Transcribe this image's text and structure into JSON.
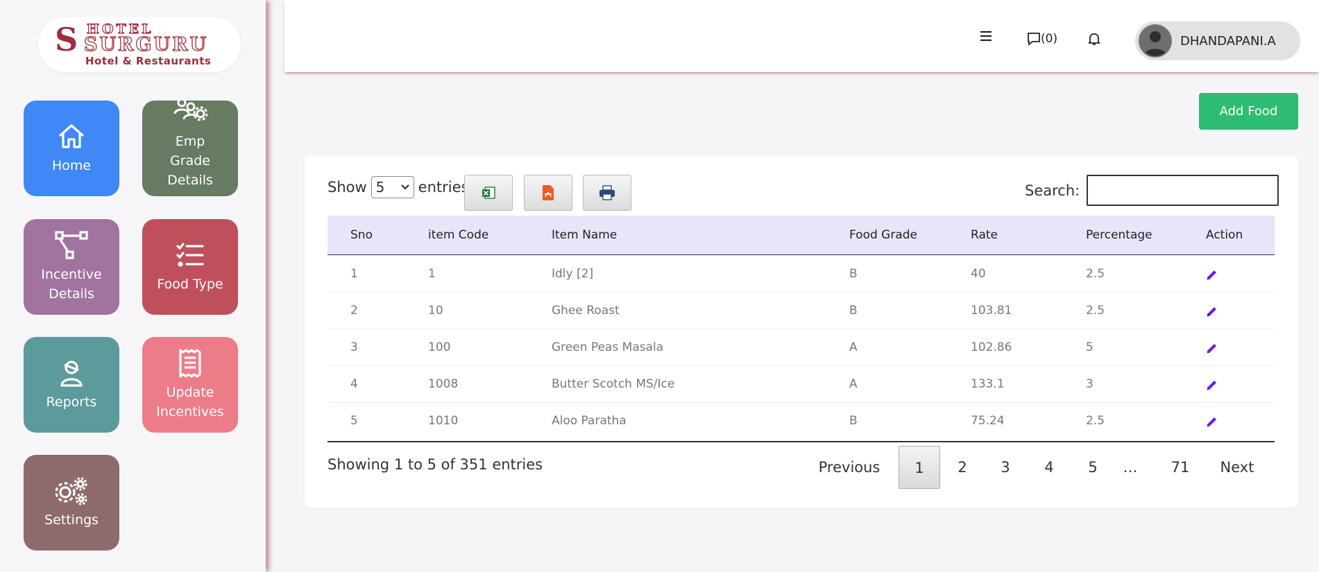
{
  "logo": {
    "letter": "S",
    "top": "HOTEL",
    "name": "SURGURU",
    "sub": "Hotel & Restaurants"
  },
  "sidebar": {
    "tiles": [
      {
        "label": "Home",
        "color": "#3f88f5",
        "icon": "home-icon"
      },
      {
        "label": "Emp Grade Details",
        "color": "#677a62",
        "icon": "users-gear-icon"
      },
      {
        "label": "Incentive Details",
        "color": "#a0749f",
        "icon": "sitemap-icon"
      },
      {
        "label": "Food Type",
        "color": "#c04f5c",
        "icon": "list-check-icon"
      },
      {
        "label": "Reports",
        "color": "#5c9a9b",
        "icon": "user-report-icon"
      },
      {
        "label": "Update Incentives",
        "color": "#ec7c88",
        "icon": "receipt-icon"
      },
      {
        "label": "Settings",
        "color": "#8d6b6c",
        "icon": "gears-icon"
      }
    ]
  },
  "topbar": {
    "messages": "(0)",
    "user_name": "DHANDAPANI.A"
  },
  "add_button": "Add Food",
  "table_controls": {
    "show": "Show",
    "length_value": "5",
    "entries": "entries",
    "search_label": "Search:",
    "search_value": ""
  },
  "table": {
    "headers": [
      "Sno",
      "item Code",
      "Item Name",
      "Food Grade",
      "Rate",
      "Percentage",
      "Action"
    ],
    "rows": [
      [
        "1",
        "1",
        "Idly [2]",
        "B",
        "40",
        "2.5"
      ],
      [
        "2",
        "10",
        "Ghee Roast",
        "B",
        "103.81",
        "2.5"
      ],
      [
        "3",
        "100",
        "Green Peas Masala",
        "A",
        "102.86",
        "5"
      ],
      [
        "4",
        "1008",
        "Butter Scotch MS/Ice",
        "A",
        "133.1",
        "3"
      ],
      [
        "5",
        "1010",
        "Aloo Paratha",
        "B",
        "75.24",
        "2.5"
      ]
    ]
  },
  "footer": {
    "info": "Showing 1 to 5 of 351 entries",
    "previous": "Previous",
    "pages": [
      "1",
      "2",
      "3",
      "4",
      "5",
      "…",
      "71"
    ],
    "next": "Next"
  }
}
